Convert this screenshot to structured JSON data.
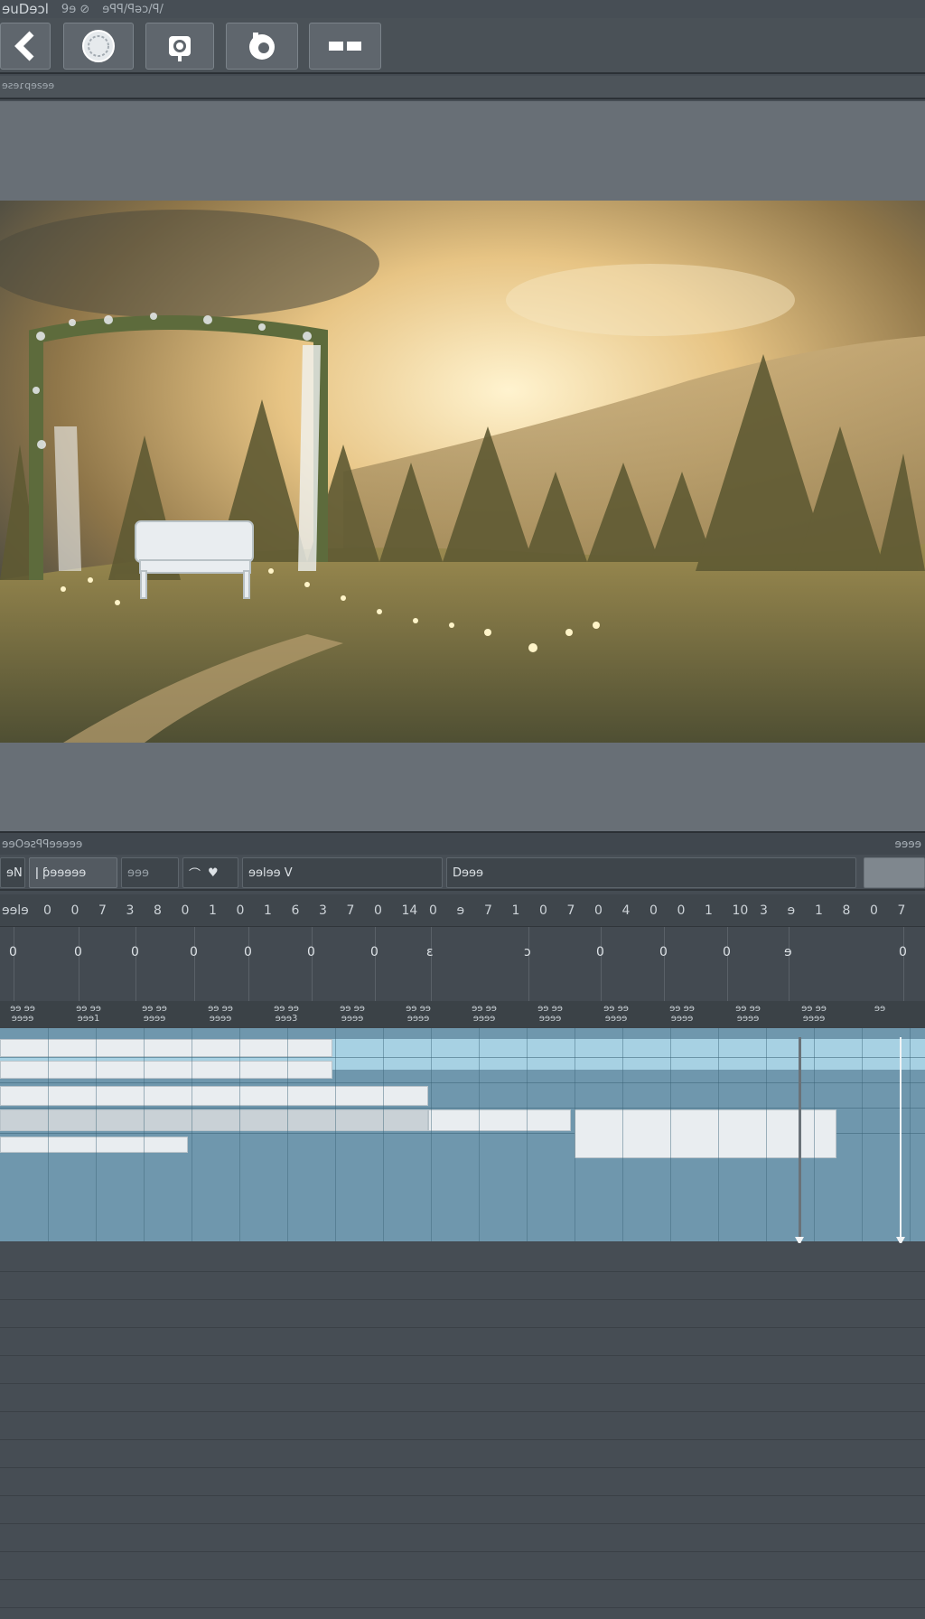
{
  "app": {
    "title": "ɘuDɘɔl",
    "title_extra": "9ɘ ⊘",
    "menu_hint": "ɘꟼꟼ/ꟼǝɔ/ꟼ/"
  },
  "toolbar": {
    "buttons": [
      {
        "icon": "back-chevron-icon"
      },
      {
        "icon": "circle-target-icon"
      },
      {
        "icon": "camera-icon"
      },
      {
        "icon": "aperture-icon"
      },
      {
        "icon": "layout-icon"
      }
    ]
  },
  "subbar": {
    "text": "ɘƨɘɾqɘsɘɘ"
  },
  "viewer": {
    "background": "#686f76"
  },
  "timeline": {
    "header_left": "ɘɘOɘƨꟼꟼɘɘɘɘɘ",
    "header_right": "ɘɘɘɘ",
    "controls": {
      "left_fragment": "ɘN",
      "preset_button": "ǀ ƥɘɘɘɘɘ",
      "gray_button": "ɘɘɘ",
      "style_dropdown": "ɘɘlɘɘ V",
      "field_value": "Dɘɘɘ"
    },
    "ruler_labels": [
      "ɘɘlɘ",
      "0",
      "0",
      "7",
      "3",
      "8",
      "0",
      "1",
      "0",
      "1",
      "6",
      "3",
      "7",
      "0",
      "14",
      "0",
      "ɘ",
      "7",
      "1",
      "0",
      "7",
      "0",
      "4",
      "0",
      "0",
      "1",
      "10",
      "3",
      "ɘ",
      "1",
      "8",
      "0",
      "7"
    ],
    "marks": [
      "0",
      "0",
      "0",
      "0",
      "0",
      "0",
      "0",
      "ɛ",
      "ɔ",
      "0",
      "0",
      "0",
      "ɘ",
      "0"
    ],
    "clip_labels": [
      "ɘɘ ɘɘ\nɘɘɘɘ",
      "ɘɘ ɘɘ\nɘɘɘ1",
      "ɘɘ ɘɘ\nɘɘɘɘ",
      "ɘɘ ɘɘ\nɘɘɘɘ",
      "ɘɘ ɘɘ\nɘɘɘ3",
      "ɘɘ ɘɘ\nɘɘɘɘ",
      "ɘɘ ɘɘ\nɘɘɘɘ",
      "ɘɘ ɘɘ\nɘɘɘɘ",
      "ɘɘ ɘɘ\nɘɘɘɘ",
      "ɘɘ ɘɘ\nɘɘɘɘ",
      "ɘɘ ɘɘ\nɘɘɘɘ",
      "ɘɘ ɘɘ\nɘɘɘɘ",
      "ɘɘ ɘɘ\nɘɘɘɘ",
      "ɘɘ"
    ],
    "colors": {
      "track": "#6f97ad",
      "highlight": "#a7d1e3",
      "clip": "#e9edf0"
    }
  }
}
